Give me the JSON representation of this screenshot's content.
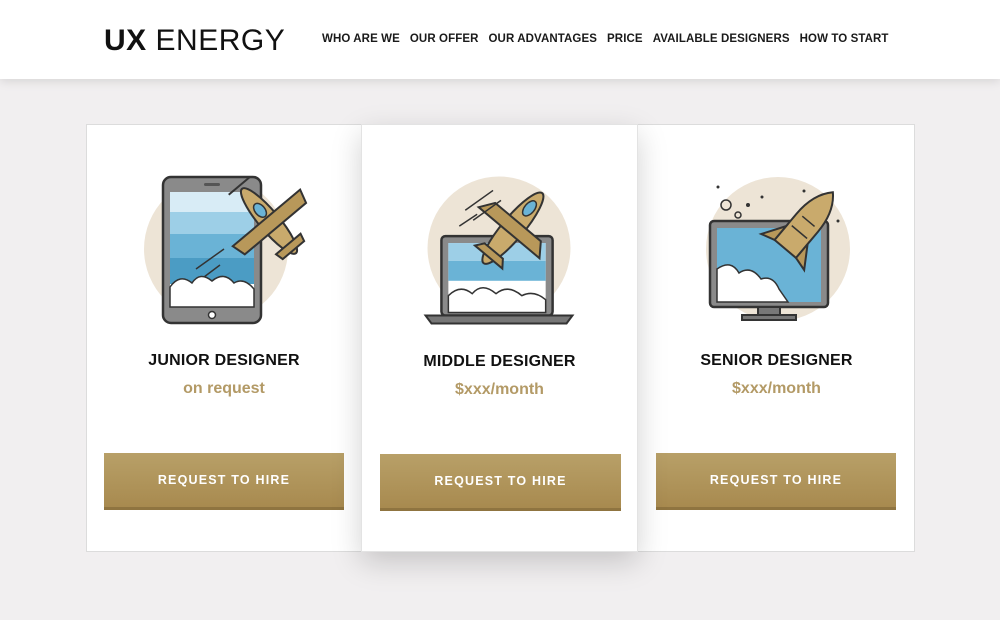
{
  "brand": {
    "bold": "UX",
    "light": "ENERGY"
  },
  "nav": [
    "WHO ARE WE",
    "OUR OFFER",
    "OUR ADVANTAGES",
    "PRICE",
    "AVAILABLE DESIGNERS",
    "HOW TO START"
  ],
  "cards": [
    {
      "title": "JUNIOR DESIGNER",
      "price": "on request",
      "button": "REQUEST TO HIRE",
      "illustration": "tablet-plane-icon"
    },
    {
      "title": "MIDDLE DESIGNER",
      "price": "$xxx/month",
      "button": "REQUEST TO HIRE",
      "illustration": "laptop-jet-icon"
    },
    {
      "title": "SENIOR DESIGNER",
      "price": "$xxx/month",
      "button": "REQUEST TO HIRE",
      "illustration": "monitor-shuttle-icon"
    }
  ],
  "colors": {
    "accent": "#b39a66",
    "button": "#ad9158",
    "background": "#f1eff0",
    "sky": "#6ab3d6"
  }
}
